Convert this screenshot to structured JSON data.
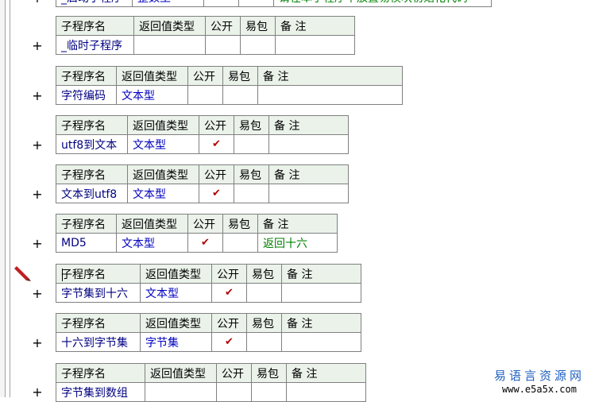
{
  "header": {
    "name": "子程序名",
    "ret": "返回值类型",
    "pub": "公开",
    "easy": "易包",
    "note": "备 注"
  },
  "check": "✔",
  "plus": "+",
  "top_partial": {
    "name": "_启动子程序",
    "ret": "整数型",
    "note": "请在本子程序中放置易模块初始化代码"
  },
  "subs": [
    {
      "name": "_临时子程序",
      "ret": "",
      "pub": "",
      "note": ""
    },
    {
      "name": "字符编码",
      "ret": "文本型",
      "pub": "",
      "note": ""
    },
    {
      "name": "utf8到文本",
      "ret": "文本型",
      "pub": "✔",
      "note": ""
    },
    {
      "name": "文本到utf8",
      "ret": "文本型",
      "pub": "✔",
      "note": ""
    },
    {
      "name": "MD5",
      "ret": "文本型",
      "pub": "✔",
      "note": "返回十六"
    },
    {
      "name": "字节集到十六",
      "ret": "文本型",
      "pub": "✔",
      "note": ""
    },
    {
      "name": "十六到字节集",
      "ret": "字节集",
      "pub": "✔",
      "note": ""
    },
    {
      "name": "字节集到数组",
      "ret": "",
      "pub": "",
      "note": ""
    }
  ],
  "watermark": {
    "line1": "易语言资源网",
    "line2": "www.e5a5x.com"
  },
  "colors": {
    "header_bg": "#eaf2ea",
    "name": "#000080",
    "type": "#0000c0",
    "comment": "#008000",
    "check": "#b00000"
  }
}
